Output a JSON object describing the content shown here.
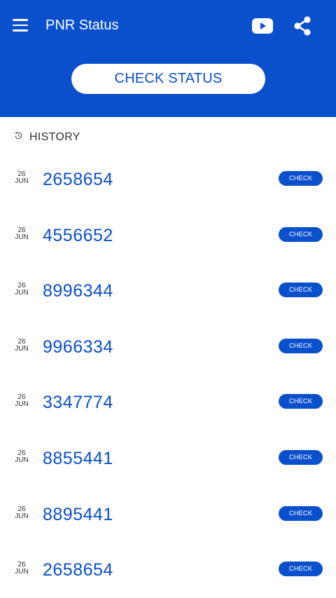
{
  "header": {
    "title": "PNR Status",
    "check_status_label": "CHECK STATUS",
    "accent_color": "#0a4fcc"
  },
  "history": {
    "label": "HISTORY",
    "items": [
      {
        "day": "26",
        "month": "JUN",
        "pnr": "2658654",
        "action": "CHECK"
      },
      {
        "day": "26",
        "month": "JUN",
        "pnr": "4556652",
        "action": "CHECK"
      },
      {
        "day": "26",
        "month": "JUN",
        "pnr": "8996344",
        "action": "CHECK"
      },
      {
        "day": "26",
        "month": "JUN",
        "pnr": "9966334",
        "action": "CHECK"
      },
      {
        "day": "26",
        "month": "JUN",
        "pnr": "3347774",
        "action": "CHECK"
      },
      {
        "day": "26",
        "month": "JUN",
        "pnr": "8855441",
        "action": "CHECK"
      },
      {
        "day": "26",
        "month": "JUN",
        "pnr": "8895441",
        "action": "CHECK"
      },
      {
        "day": "26",
        "month": "JUN",
        "pnr": "2658654",
        "action": "CHECK"
      }
    ]
  },
  "icons": {
    "menu": "menu-icon",
    "youtube": "youtube-icon",
    "share": "share-icon",
    "history": "history-icon"
  }
}
